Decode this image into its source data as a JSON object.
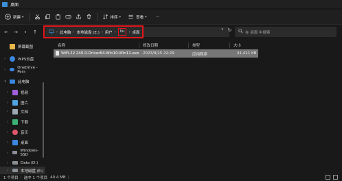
{
  "window": {
    "title": "桌面"
  },
  "toolbar": {
    "new_label": "新建",
    "sort_label": "排序",
    "view_label": "查看",
    "more_label": "···"
  },
  "address": {
    "crumbs": [
      "此电脑",
      "本地磁盘 (E:)",
      "用户",
      "liu",
      "桌面"
    ]
  },
  "search": {
    "placeholder": "在 桌面 中搜索"
  },
  "sidebar": {
    "items": [
      {
        "label": "屏幕截图",
        "icon": "folder-icon",
        "color": "#e8b64a"
      },
      {
        "label": "WPS云盘",
        "icon": "cloud-icon",
        "color": "#3a87e0"
      },
      {
        "label": "OneDrive - Pers",
        "icon": "onedrive-icon",
        "color": "#3a87e0"
      },
      {
        "label": "此电脑",
        "icon": "computer-icon",
        "color": "#3a87e0"
      },
      {
        "label": "视频",
        "icon": "video-icon",
        "color": "#a05ed8"
      },
      {
        "label": "图片",
        "icon": "picture-icon",
        "color": "#4fa3e0"
      },
      {
        "label": "文档",
        "icon": "document-icon",
        "color": "#9aa6b2"
      },
      {
        "label": "下载",
        "icon": "download-icon",
        "color": "#3bb273"
      },
      {
        "label": "音乐",
        "icon": "music-icon",
        "color": "#e0556a"
      },
      {
        "label": "桌面",
        "icon": "desktop-icon",
        "color": "#3a87e0"
      },
      {
        "label": "Windows-SSD",
        "icon": "drive-icon",
        "color": "#8a8f96"
      },
      {
        "label": "Data (D:)",
        "icon": "drive-icon",
        "color": "#8a8f96"
      },
      {
        "label": "本地磁盘 (E:)",
        "icon": "drive-icon",
        "color": "#8a8f96"
      }
    ]
  },
  "columns": {
    "name": "名称",
    "modified": "修改日期",
    "type": "类型",
    "size": "大小"
  },
  "files": [
    {
      "name": "WiFi-22.240.0-Driver64-Win10-Win11.exe",
      "modified": "2023/9/25 22:29",
      "type": "应用程序",
      "size": "41,411 KB"
    }
  ],
  "status": {
    "count": "1 个项目",
    "selected": "选中 1 个项目",
    "selected_size": "40.4 MB"
  },
  "colors": {
    "highlight": "#e2161b",
    "selection": "#777777"
  }
}
